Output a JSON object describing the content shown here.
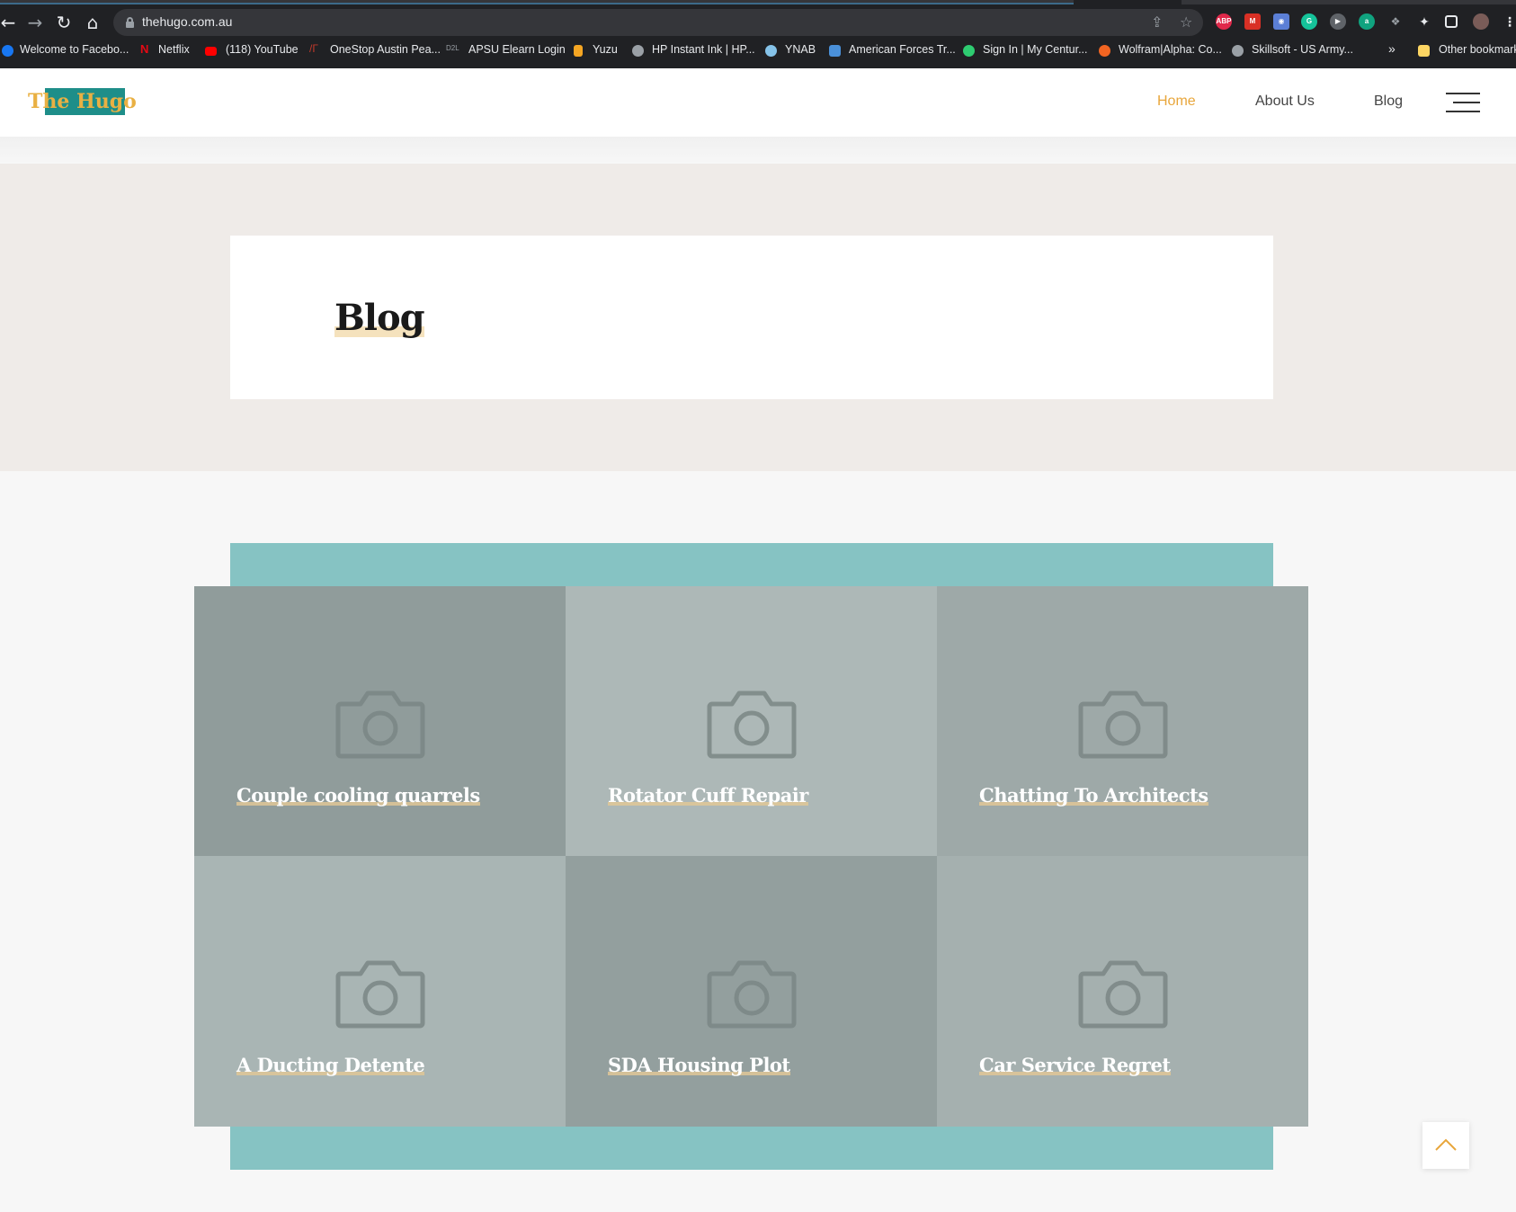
{
  "browser": {
    "url": "thehugo.com.au",
    "bookmarks": [
      {
        "label": "Welcome to Facebo...",
        "icon": "facebook-icon",
        "color": "#1877f2"
      },
      {
        "label": "Netflix",
        "icon": "netflix-icon",
        "color": "#e50914"
      },
      {
        "label": "(118) YouTube",
        "icon": "youtube-icon",
        "color": "#ff0000"
      },
      {
        "label": "OneStop Austin Pea...",
        "icon": "onestop-icon",
        "color": "#c0392b"
      },
      {
        "label": "APSU Elearn Login",
        "icon": "d2l-icon",
        "color": "#9aa0a6"
      },
      {
        "label": "Yuzu",
        "icon": "yuzu-icon",
        "color": "#f5a623"
      },
      {
        "label": "HP Instant Ink | HP...",
        "icon": "globe-icon",
        "color": "#9aa0a6"
      },
      {
        "label": "YNAB",
        "icon": "ynab-icon",
        "color": "#85c3e9"
      },
      {
        "label": "American Forces Tr...",
        "icon": "afn-icon",
        "color": "#4a90d9"
      },
      {
        "label": "Sign In | My Centur...",
        "icon": "century-icon",
        "color": "#2ecc71"
      },
      {
        "label": "Wolfram|Alpha: Co...",
        "icon": "wolfram-icon",
        "color": "#f26522"
      },
      {
        "label": "Skillsoft - US Army...",
        "icon": "globe-icon",
        "color": "#9aa0a6"
      }
    ],
    "overflow": "»",
    "other_bookmarks": "Other bookmarks"
  },
  "site": {
    "logo": "The Hugo",
    "nav": [
      {
        "label": "Home",
        "active": true
      },
      {
        "label": "About Us",
        "active": false
      },
      {
        "label": "Blog",
        "active": false
      }
    ],
    "accent": "#e8a63b",
    "teal": "#86c3c3"
  },
  "hero": {
    "title": "Blog"
  },
  "posts": [
    {
      "title": "Couple cooling quarrels",
      "bg": "#909c9b"
    },
    {
      "title": "Rotator Cuff Repair",
      "bg": "#adb8b7"
    },
    {
      "title": "Chatting To Architects",
      "bg": "#9ea9a8"
    },
    {
      "title": "A Ducting Detente",
      "bg": "#a9b5b4"
    },
    {
      "title": "SDA Housing Plot",
      "bg": "#939f9e"
    },
    {
      "title": "Car Service Regret",
      "bg": "#a5b0af"
    }
  ]
}
